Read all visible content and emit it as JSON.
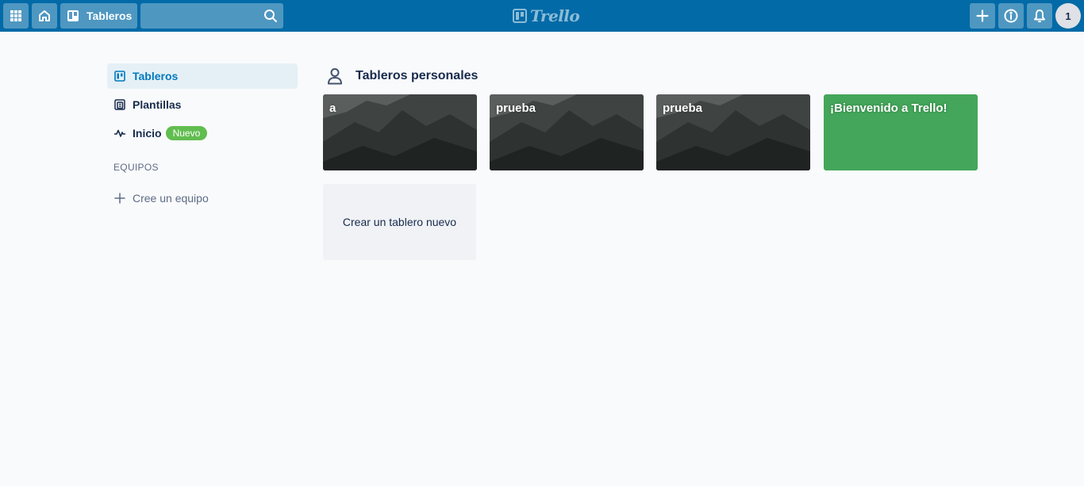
{
  "header": {
    "boards_label": "Tableros",
    "search_value": "",
    "logo_text": "Trello",
    "avatar_initial": "1"
  },
  "sidebar": {
    "items": [
      {
        "label": "Tableros",
        "icon": "board-icon",
        "active": true
      },
      {
        "label": "Plantillas",
        "icon": "template-icon",
        "active": false
      },
      {
        "label": "Inicio",
        "icon": "activity-icon",
        "active": false,
        "badge": "Nuevo"
      }
    ],
    "teams_title": "EQUIPOS",
    "create_team_label": "Cree un equipo"
  },
  "main": {
    "section_title": "Tableros personales",
    "section_icon": "person-icon",
    "boards": [
      {
        "name": "a",
        "background": "mountain-photo"
      },
      {
        "name": "prueba",
        "background": "mountain-photo"
      },
      {
        "name": "prueba",
        "background": "mountain-photo"
      },
      {
        "name": "¡Bienvenido a Trello!",
        "background": "#43a65a"
      }
    ],
    "create_board_label": "Crear un tablero nuevo"
  },
  "colors": {
    "header": "#026aa7",
    "accent": "#0079bf",
    "badge": "#61bd4f",
    "green_board": "#43a65a"
  }
}
